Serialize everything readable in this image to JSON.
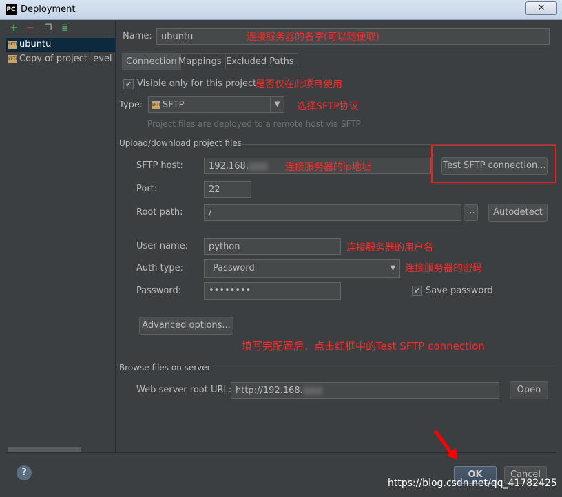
{
  "window": {
    "title": "Deployment",
    "logo": "PC",
    "close_glyph": "✕"
  },
  "sidebar": {
    "toolbar_icons": [
      "add-icon",
      "remove-icon",
      "copy-icon",
      "default-icon"
    ],
    "items": [
      {
        "label": "ubuntu",
        "selected": true
      },
      {
        "label": "Copy of project-level se",
        "selected": false
      }
    ]
  },
  "name_field": {
    "label": "Name:",
    "value": "ubuntu"
  },
  "tabs": [
    {
      "label": "Connection",
      "active": true
    },
    {
      "label": "Mappings",
      "active": false
    },
    {
      "label": "Excluded Paths",
      "active": false
    }
  ],
  "visible_only": {
    "label": "Visible only for this project",
    "checked": true
  },
  "type": {
    "label": "Type:",
    "value": "SFTP",
    "hint": "Project files are deployed to a remote host via SFTP"
  },
  "upload_section": {
    "title": "Upload/download project files"
  },
  "sftp_host": {
    "label": "SFTP host:",
    "value": "192.168."
  },
  "test_button": {
    "label": "Test SFTP connection..."
  },
  "port": {
    "label": "Port:",
    "value": "22"
  },
  "root_path": {
    "label": "Root path:",
    "value": "/",
    "browse": "...",
    "autodetect": "Autodetect"
  },
  "user_name": {
    "label": "User name:",
    "value": "python"
  },
  "auth_type": {
    "label": "Auth type:",
    "value": "Password"
  },
  "password": {
    "label": "Password:",
    "value": "••••••••",
    "save_label": "Save password",
    "save_checked": true
  },
  "advanced_button": {
    "label": "Advanced options..."
  },
  "browse_section": {
    "title": "Browse files on server"
  },
  "web_root": {
    "label": "Web server root URL:",
    "value": "http://192.168.",
    "open": "Open"
  },
  "footer": {
    "ok": "OK",
    "cancel": "Cancel",
    "help": "?",
    "watermark": "https://blog.csdn.net/qq_41782425"
  },
  "annotations": {
    "name": "连接服务器的名字(可以随便取)",
    "visible": "是否仅在此项目使用",
    "type": "选择SFTP协议",
    "host": "连接服务器的ip地址",
    "user": "连接服务器的用户名",
    "password": "连接服务器的密码",
    "instruction": "填写完配置后，点击红框中的Test SFTP connection"
  },
  "colors": {
    "background": "#3c3f41",
    "annotation": "#ff2a2a",
    "selection": "#0d293e"
  }
}
